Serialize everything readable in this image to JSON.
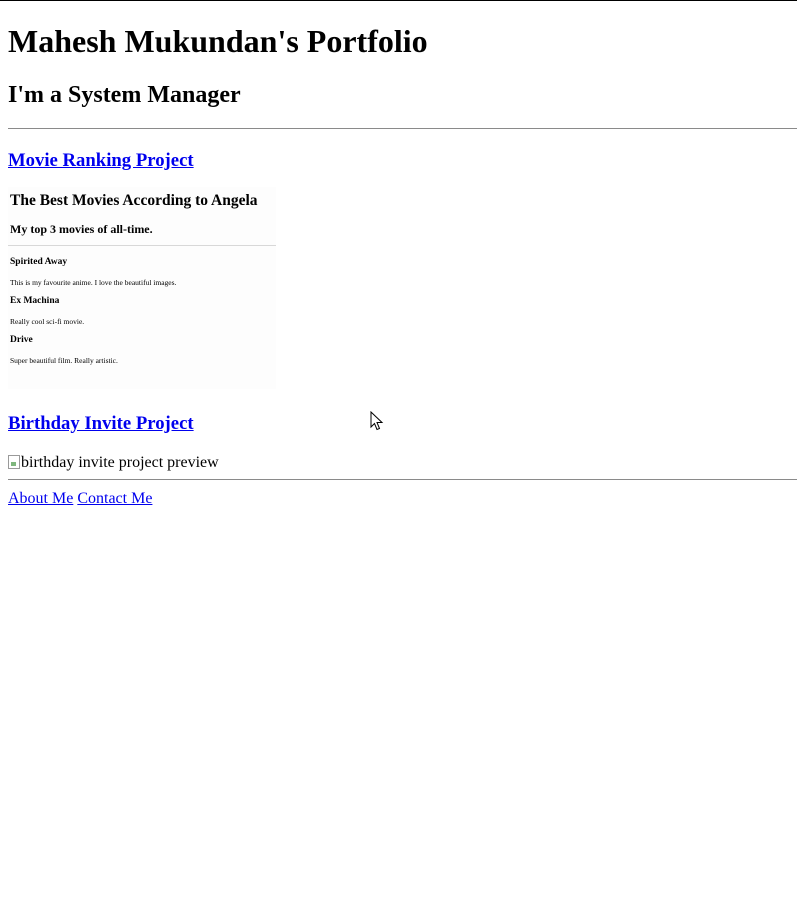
{
  "header": {
    "title": "Mahesh Mukundan's Portfolio",
    "subtitle": "I'm a System Manager"
  },
  "projects": [
    {
      "link_label": "Movie Ranking Project",
      "preview": {
        "title": "The Best Movies According to Angela",
        "subtitle": "My top 3 movies of all-time.",
        "movies": [
          {
            "name": "Spirited Away",
            "desc": "This is my favourite anime. I love the beautiful images."
          },
          {
            "name": "Ex Machina",
            "desc": "Really cool sci-fi movie."
          },
          {
            "name": "Drive",
            "desc": "Super beautiful film. Really artistic."
          }
        ]
      }
    },
    {
      "link_label": "Birthday Invite Project",
      "image_alt": "birthday invite project preview"
    }
  ],
  "footer": {
    "about_label": "About Me",
    "contact_label": "Contact Me"
  },
  "icons": {
    "cursor": "mouse-pointer-icon",
    "broken_image": "broken-image-icon"
  },
  "colors": {
    "link": "#0000ee",
    "rule": "#8a8a8a"
  }
}
